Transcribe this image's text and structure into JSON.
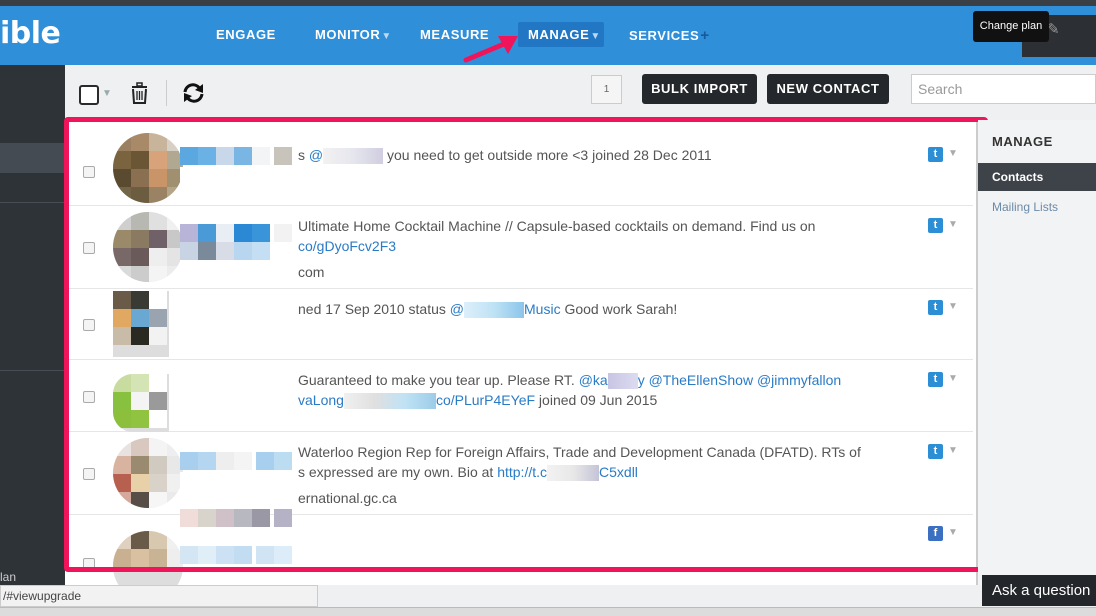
{
  "app": {
    "logo": "ible",
    "colors": {
      "nav": "#2f8fd8",
      "accent": "#f0145a",
      "dark": "#24272b"
    }
  },
  "nav": {
    "engage": "ENGAGE",
    "monitor": "MONITOR",
    "measure": "MEASURE",
    "manage": "MANAGE",
    "services": "SERVICES",
    "tooltip": "Change plan"
  },
  "toolbar": {
    "page_number": "1",
    "bulk_import": "BULK IMPORT",
    "new_contact": "NEW CONTACT",
    "search_placeholder": "Search"
  },
  "contacts": [
    {
      "bio_pre": "s ",
      "bio_link": "@",
      "bio_post": " you need to get outside more <3 joined 28 Dec 2011",
      "bio_line2": "",
      "bio_line3": "",
      "network": "twitter"
    },
    {
      "bio_pre": "Ultimate Home Cocktail Machine // Capsule-based cocktails on demand. Find us on",
      "bio_line2": "co/gDyoFcv2F3",
      "bio_line3": "com",
      "network": "twitter"
    },
    {
      "bio_pre": "ned 17 Sep 2010 status ",
      "bio_link": "@",
      "bio_link2": "Music",
      "bio_post": " Good work Sarah!",
      "network": "twitter"
    },
    {
      "bio_pre": "Guaranteed to make you tear up. Please RT. ",
      "bio_link": "@ka",
      "bio_link2": "y",
      "bio_link3": "@TheEllenShow",
      "bio_link4": "@jimmyfallon",
      "bio_line2_link": "vaLong",
      "bio_line2_link2": "co/PLurP4EYeF",
      "bio_line2_post": " joined 09 Jun 2015",
      "network": "twitter"
    },
    {
      "bio_pre": "Waterloo Region Rep for Foreign Affairs, Trade and Development Canada (DFATD). RTs of",
      "bio_line2_pre": "s expressed are my own. Bio at ",
      "bio_line2_link": "http://t.c",
      "bio_line2_link2": "C5xdll",
      "bio_line3": "ernational.gc.ca",
      "network": "twitter"
    },
    {
      "network": "facebook"
    }
  ],
  "icons": {
    "twitter": "t",
    "facebook": "f"
  },
  "sidebar_right": {
    "title": "MANAGE",
    "contacts": "Contacts",
    "mailing_lists": "Mailing Lists"
  },
  "left_sidebar": {
    "plan_fragment": "lan"
  },
  "status_url": "/#viewupgrade",
  "help": "Ask a question"
}
